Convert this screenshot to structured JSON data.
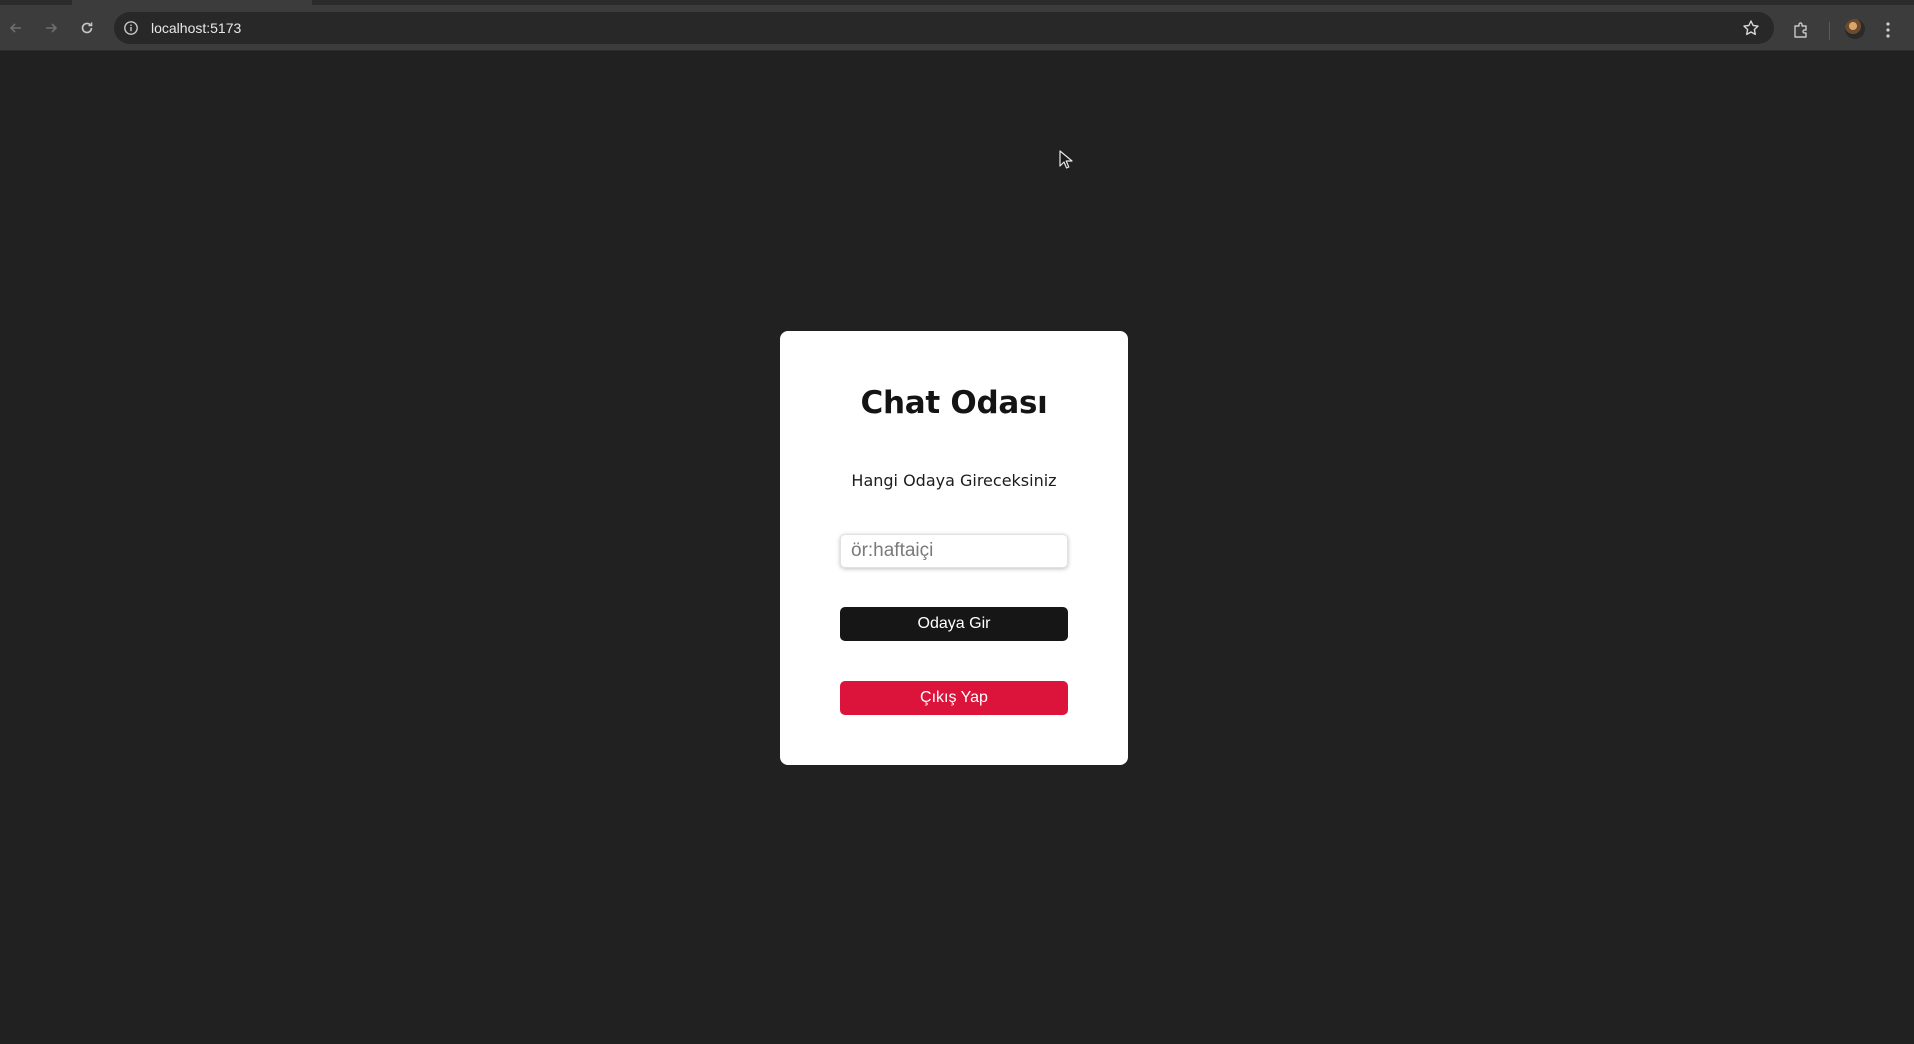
{
  "browser": {
    "url": "localhost:5173",
    "icons": {
      "back": "back-arrow-icon",
      "forward": "forward-arrow-icon",
      "reload": "reload-icon",
      "site_info": "info-icon",
      "bookmark": "star-icon",
      "extensions": "puzzle-icon",
      "profile": "avatar",
      "menu": "kebab-menu-icon"
    }
  },
  "page": {
    "background": "#212121"
  },
  "card": {
    "title": "Chat Odası",
    "subtitle": "Hangi Odaya Gireceksiniz",
    "room_input": {
      "placeholder": "ör:haftaiçi",
      "value": ""
    },
    "enter_button_label": "Odaya Gir",
    "logout_button_label": "Çıkış Yap",
    "colors": {
      "enter_button": "#161616",
      "logout_button": "#dc143c"
    }
  }
}
